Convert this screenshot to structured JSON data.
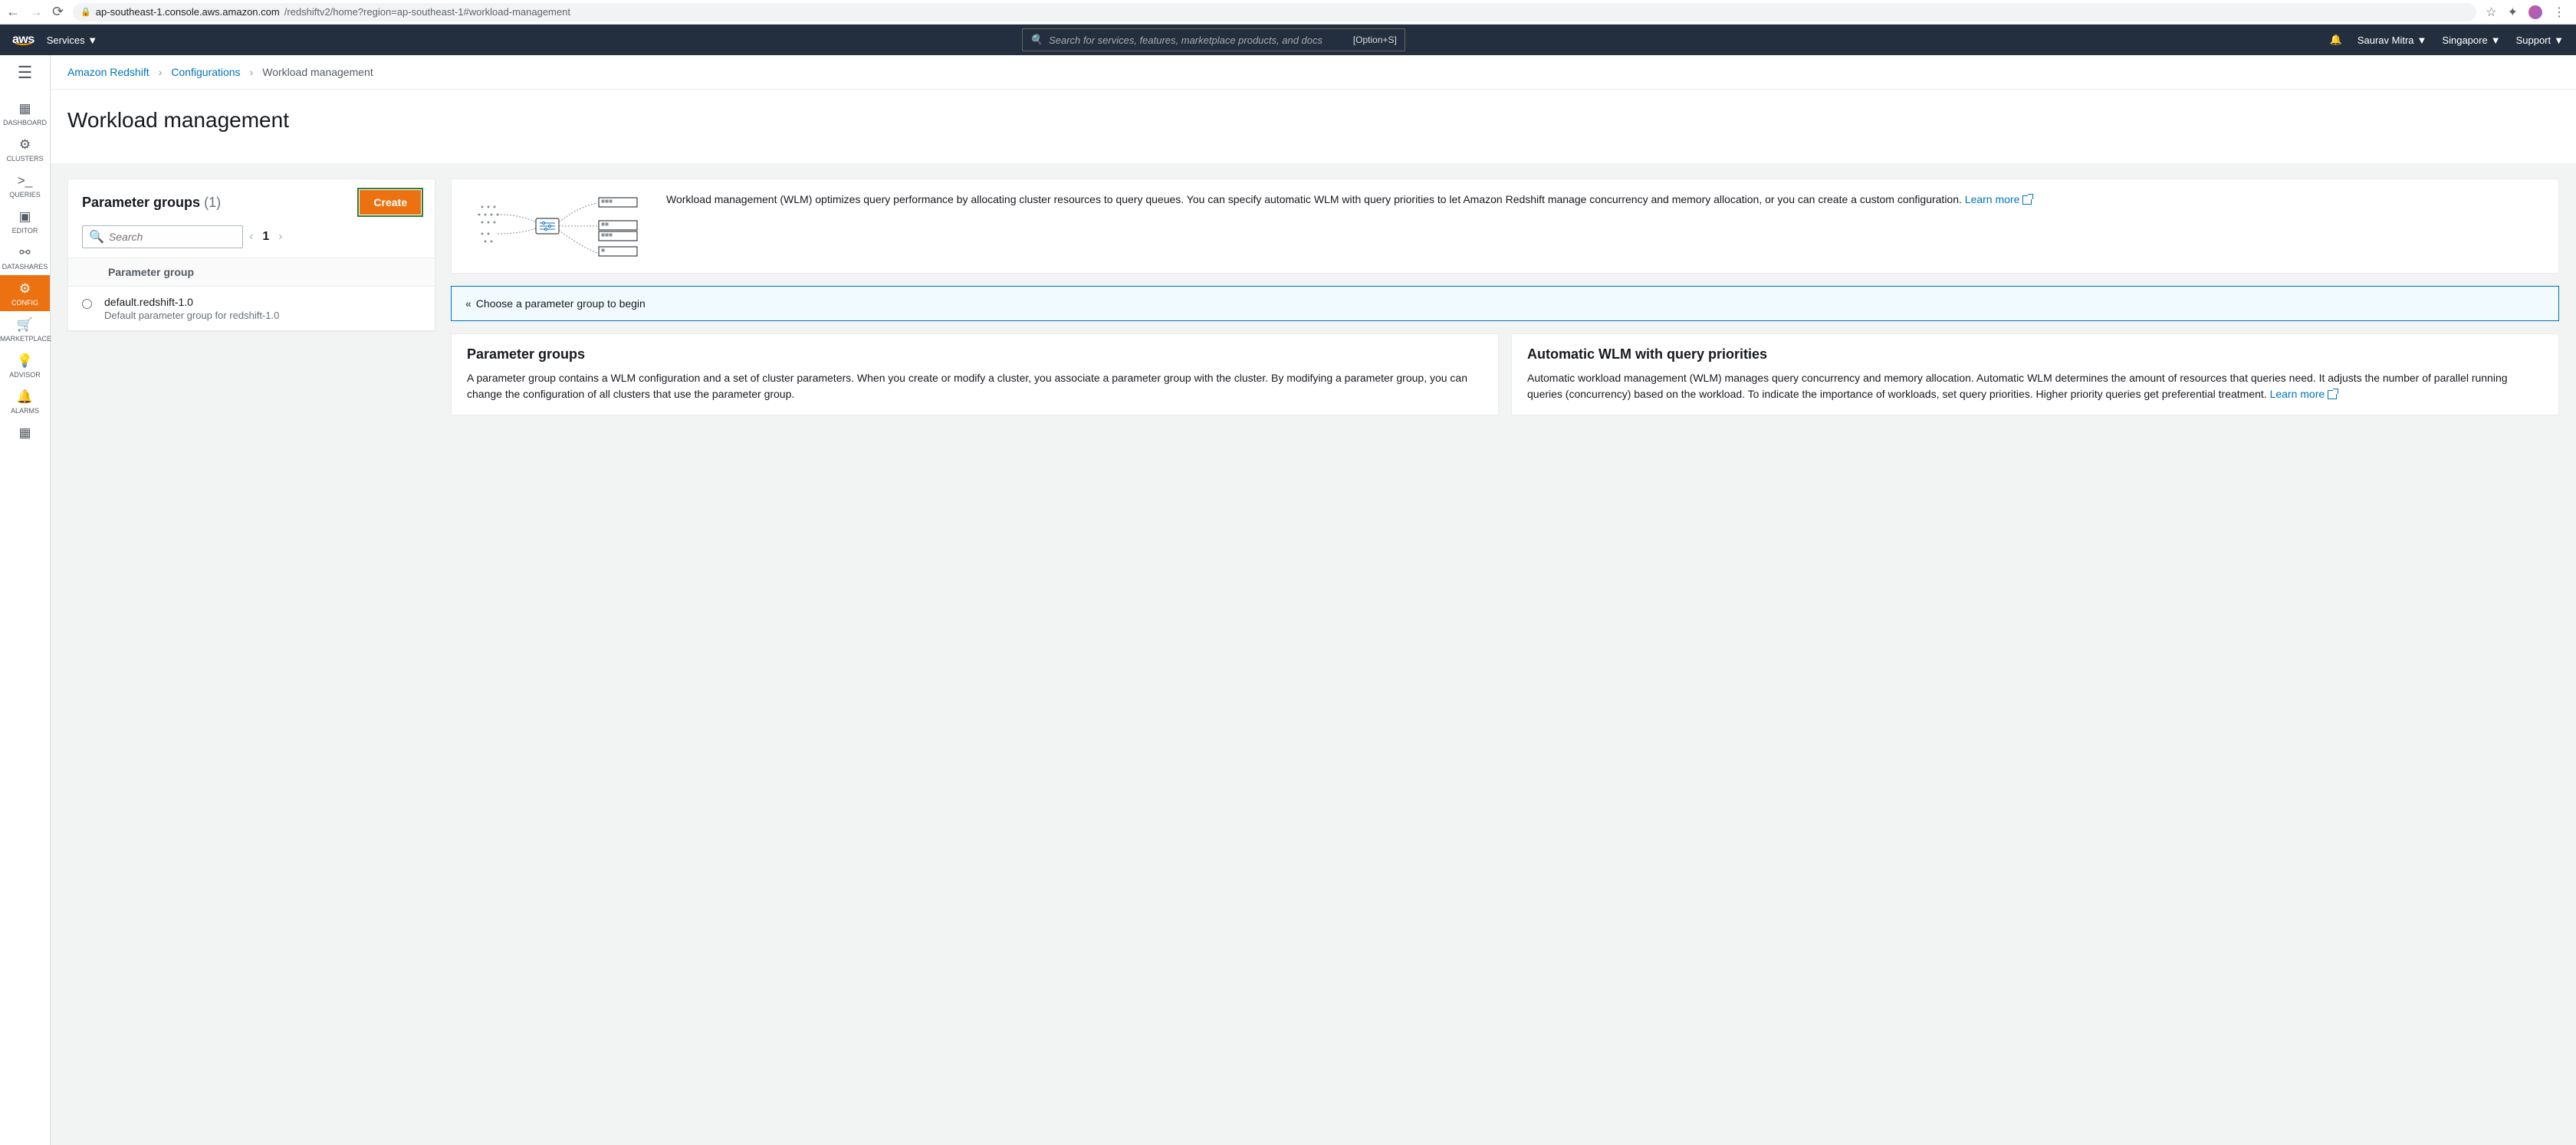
{
  "browser": {
    "url_host": "ap-southeast-1.console.aws.amazon.com",
    "url_path": "/redshiftv2/home?region=ap-southeast-1#workload-management"
  },
  "nav": {
    "services": "Services",
    "search_placeholder": "Search for services, features, marketplace products, and docs",
    "shortcut": "[Option+S]",
    "user": "Saurav Mitra",
    "region": "Singapore",
    "support": "Support"
  },
  "rail": {
    "items": [
      {
        "label": "DASHBOARD",
        "icon": "▦"
      },
      {
        "label": "CLUSTERS",
        "icon": "⚙"
      },
      {
        "label": "QUERIES",
        "icon": ">_"
      },
      {
        "label": "EDITOR",
        "icon": "▣"
      },
      {
        "label": "DATASHARES",
        "icon": "⚯"
      },
      {
        "label": "CONFIG",
        "icon": "⚙"
      },
      {
        "label": "MARKETPLACE",
        "icon": "🛒"
      },
      {
        "label": "ADVISOR",
        "icon": "💡"
      },
      {
        "label": "ALARMS",
        "icon": "🔔"
      }
    ]
  },
  "breadcrumbs": {
    "root": "Amazon Redshift",
    "mid": "Configurations",
    "current": "Workload management"
  },
  "page": {
    "title": "Workload management"
  },
  "paramPanel": {
    "title": "Parameter groups",
    "count": "(1)",
    "create": "Create",
    "search_placeholder": "Search",
    "page_num": "1",
    "col_header": "Parameter group",
    "row": {
      "name": "default.redshift-1.0",
      "desc": "Default parameter group for redshift-1.0"
    }
  },
  "info": {
    "text": "Workload management (WLM) optimizes query performance by allocating cluster resources to query queues. You can specify automatic WLM with query priorities to let Amazon Redshift manage concurrency and memory allocation, or you can create a custom configuration.  ",
    "learn_more": "Learn more"
  },
  "hint": {
    "text": "Choose a parameter group to begin"
  },
  "cards": {
    "pg": {
      "title": "Parameter groups",
      "body": "A parameter group contains a WLM configuration and a set of cluster parameters. When you create or modify a cluster, you associate a parameter group with the cluster. By modifying a parameter group, you can change the configuration of all clusters that use the parameter group."
    },
    "wlm": {
      "title": "Automatic WLM with query priorities",
      "body": "Automatic workload management (WLM) manages query concurrency and memory allocation. Automatic WLM determines the amount of resources that queries need. It adjusts the number of parallel running queries (concurrency) based on the workload. To indicate the importance of workloads, set query priorities. Higher priority queries get preferential treatment.  ",
      "learn_more": "Learn more"
    }
  }
}
